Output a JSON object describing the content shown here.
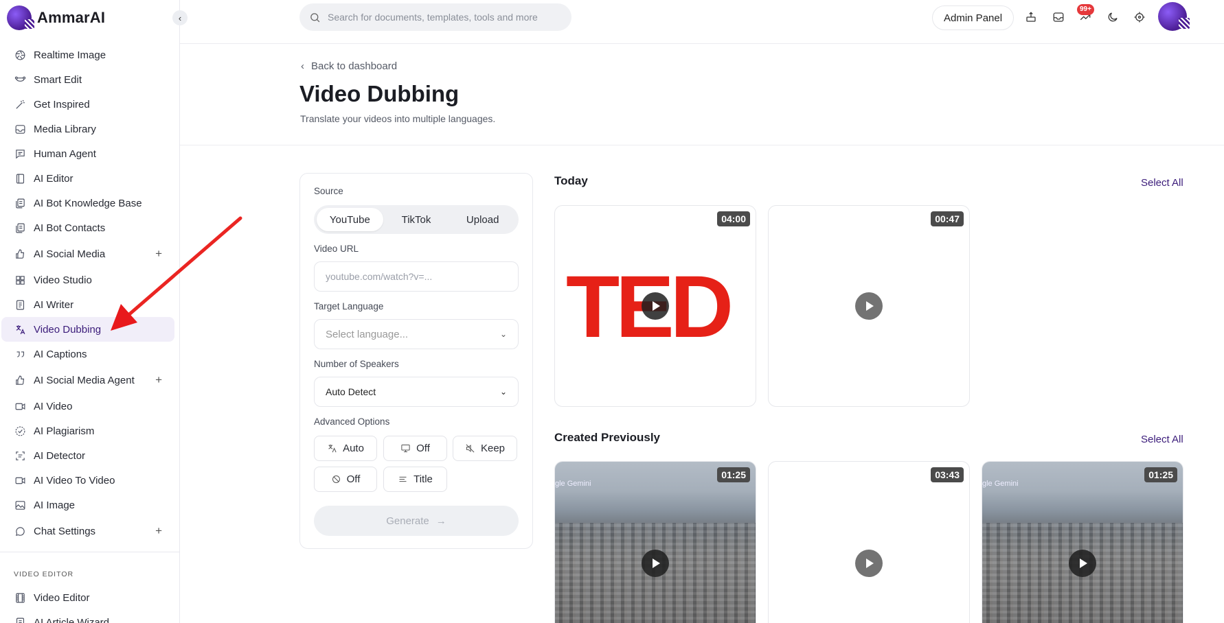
{
  "app": {
    "name": "AmmarAI"
  },
  "sidebar": {
    "items": [
      {
        "label": "Realtime Image",
        "icon": "aperture-icon"
      },
      {
        "label": "Smart Edit",
        "icon": "bezier-icon"
      },
      {
        "label": "Get Inspired",
        "icon": "magic-wand-icon"
      },
      {
        "label": "Media Library",
        "icon": "inbox-icon"
      },
      {
        "label": "Human Agent",
        "icon": "chat-icon"
      },
      {
        "label": "AI Editor",
        "icon": "notebook-icon"
      },
      {
        "label": "AI Bot Knowledge Base",
        "icon": "files-icon"
      },
      {
        "label": "AI Bot Contacts",
        "icon": "files-icon"
      },
      {
        "label": "AI Social Media",
        "icon": "thumbs-up-icon",
        "expandable": true
      },
      {
        "label": "Video Studio",
        "icon": "layout-icon"
      },
      {
        "label": "AI Writer",
        "icon": "document-icon"
      },
      {
        "label": "Video Dubbing",
        "icon": "translate-icon",
        "active": true
      },
      {
        "label": "AI Captions",
        "icon": "quote-icon"
      },
      {
        "label": "AI Social Media Agent",
        "icon": "thumbs-up-icon",
        "expandable": true
      },
      {
        "label": "AI Video",
        "icon": "video-camera-icon"
      },
      {
        "label": "AI Plagiarism",
        "icon": "check-circle-icon"
      },
      {
        "label": "AI Detector",
        "icon": "scan-text-icon"
      },
      {
        "label": "AI Video To Video",
        "icon": "video-camera-icon"
      },
      {
        "label": "AI Image",
        "icon": "image-icon"
      },
      {
        "label": "Chat Settings",
        "icon": "message-circle-icon",
        "expandable": true
      }
    ],
    "section_video_editor": "VIDEO EDITOR",
    "video_editor_items": [
      {
        "label": "Video Editor",
        "icon": "film-icon"
      },
      {
        "label": "AI Article Wizard",
        "icon": "document-icon"
      }
    ]
  },
  "topbar": {
    "search_placeholder": "Search for documents, templates, tools and more",
    "admin_label": "Admin Panel",
    "notification_badge": "99+"
  },
  "page": {
    "back_label": "Back to dashboard",
    "title": "Video Dubbing",
    "subtitle": "Translate your videos into multiple languages."
  },
  "form": {
    "source_label": "Source",
    "source_tabs": [
      "YouTube",
      "TikTok",
      "Upload"
    ],
    "source_selected": "YouTube",
    "url_label": "Video URL",
    "url_placeholder": "youtube.com/watch?v=...",
    "language_label": "Target Language",
    "language_placeholder": "Select language...",
    "speakers_label": "Number of Speakers",
    "speakers_value": "Auto Detect",
    "advanced_label": "Advanced Options",
    "advanced_options": [
      "Auto",
      "Off",
      "Keep",
      "Off",
      "Title"
    ],
    "generate_label": "Generate"
  },
  "gallery": {
    "today_title": "Today",
    "previous_title": "Created Previously",
    "select_all": "Select All",
    "today": [
      {
        "duration": "04:00",
        "thumb": "TED"
      },
      {
        "duration": "00:47"
      }
    ],
    "previous": [
      {
        "duration": "01:25",
        "watermark": "gle Gemini"
      },
      {
        "duration": "03:43"
      },
      {
        "duration": "01:25",
        "watermark": "gle Gemini"
      }
    ]
  },
  "colors": {
    "accent": "#3b1c7a",
    "ted_red": "#e62117",
    "arrow": "#e8191c"
  }
}
